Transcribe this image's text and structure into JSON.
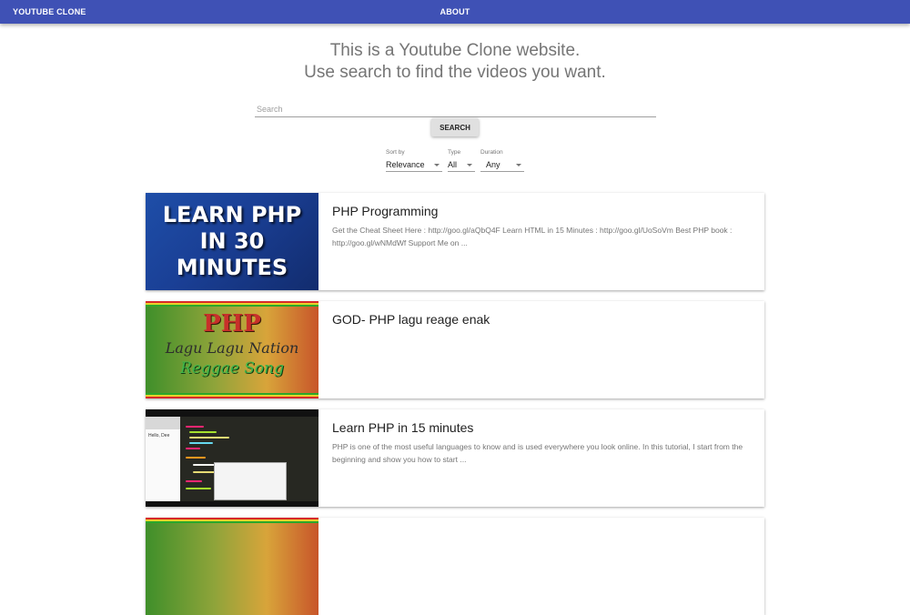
{
  "appbar": {
    "brand": "YOUTUBE CLONE",
    "about": "ABOUT",
    "color": "#3f51b5"
  },
  "hero": {
    "line1": "This is a Youtube Clone website.",
    "line2": "Use search to find the videos you want."
  },
  "search": {
    "placeholder": "Search",
    "value": "",
    "button_label": "SEARCH"
  },
  "filters": {
    "sort": {
      "label": "Sort by",
      "value": "Relevance"
    },
    "type": {
      "label": "Type",
      "value": "All"
    },
    "duration": {
      "label": "Duration",
      "value": "Any"
    }
  },
  "videos": [
    {
      "title": "PHP Programming",
      "description": "Get the Cheat Sheet Here : http://goo.gl/aQbQ4F Learn HTML in 15 Minutes : http://goo.gl/UoSoVm Best PHP book : http://goo.gl/wNMdWf Support Me on ...",
      "thumb_text": [
        "LEARN PHP",
        "IN 30",
        "MINUTES"
      ]
    },
    {
      "title": "GOD- PHP lagu reage enak",
      "description": "",
      "thumb_text": [
        "PHP",
        "Lagu Lagu Nation",
        "Reggae Song"
      ]
    },
    {
      "title": "Learn PHP in 15 minutes",
      "description": "PHP is one of the most useful languages to know and is used everywhere you look online. In this tutorial, I start from the beginning and show you how to start ...",
      "thumb_text": [
        "Hello, Dee"
      ]
    },
    {
      "title": "",
      "description": ""
    }
  ]
}
